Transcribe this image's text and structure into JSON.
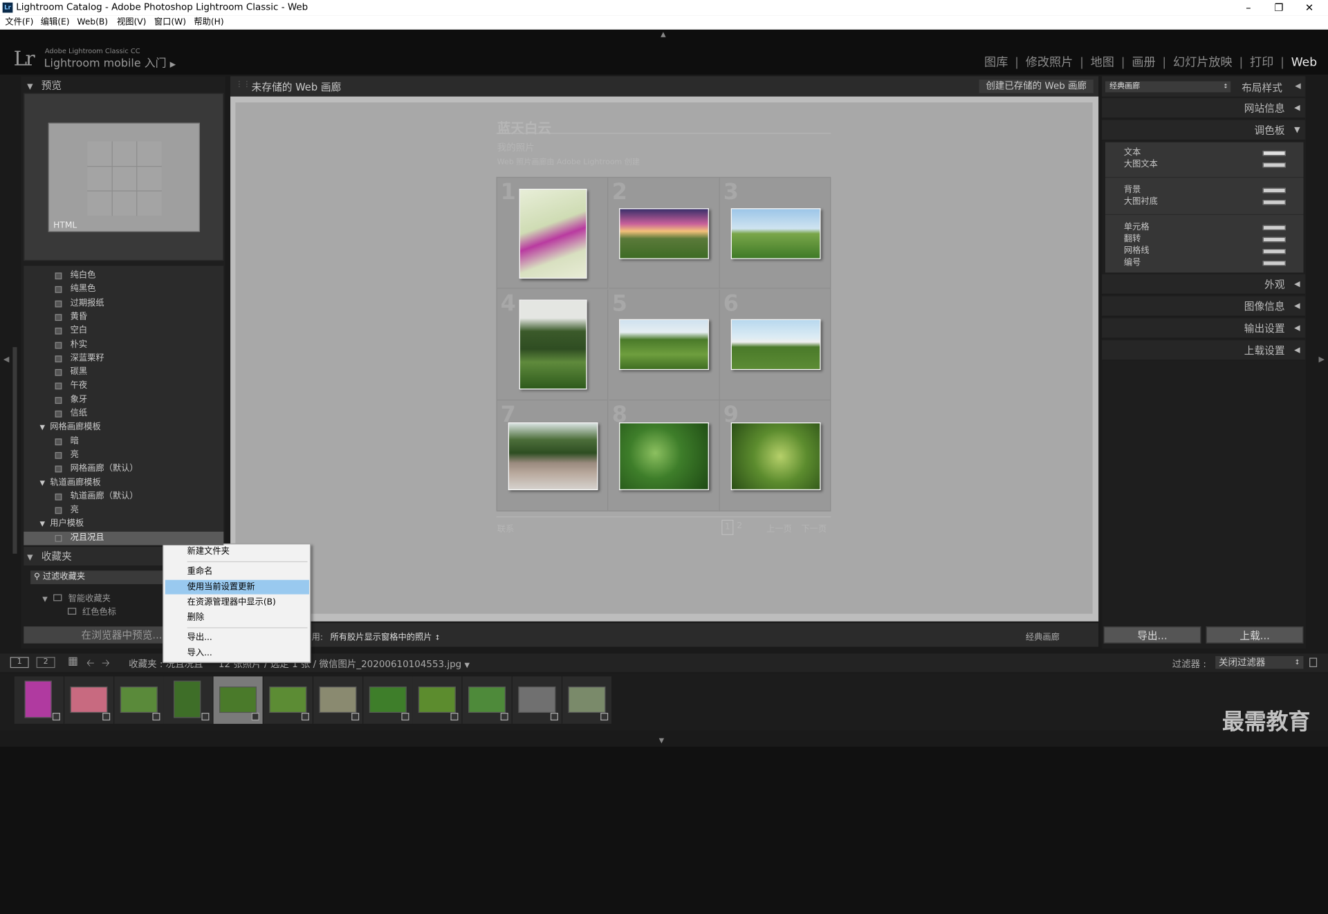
{
  "window": {
    "title": "Lightroom Catalog - Adobe Photoshop Lightroom Classic - Web",
    "app_icon": "Lr",
    "controls": [
      "minimize-icon",
      "maximize-icon",
      "close-icon"
    ]
  },
  "menubar": [
    "文件(F)",
    "编辑(E)",
    "Web(B)",
    "视图(V)",
    "窗口(W)",
    "帮助(H)"
  ],
  "header": {
    "logo": "Lr",
    "brand_line1": "Adobe Lightroom Classic CC",
    "brand_line2": "Lightroom mobile 入门",
    "modules": [
      "图库",
      "修改照片",
      "地图",
      "画册",
      "幻灯片放映",
      "打印",
      "Web"
    ],
    "active_module": "Web"
  },
  "left": {
    "preview_title": "预览",
    "preview_label": "HTML",
    "templates": [
      {
        "label": "纯白色",
        "type": "item"
      },
      {
        "label": "纯黑色",
        "type": "item"
      },
      {
        "label": "过期报纸",
        "type": "item"
      },
      {
        "label": "黄昏",
        "type": "item"
      },
      {
        "label": "空白",
        "type": "item"
      },
      {
        "label": "朴实",
        "type": "item"
      },
      {
        "label": "深蓝栗籽",
        "type": "item"
      },
      {
        "label": "碳黑",
        "type": "item"
      },
      {
        "label": "午夜",
        "type": "item"
      },
      {
        "label": "象牙",
        "type": "item"
      },
      {
        "label": "信纸",
        "type": "item"
      },
      {
        "label": "网格画廊模板",
        "type": "folder"
      },
      {
        "label": "暗",
        "type": "item"
      },
      {
        "label": "亮",
        "type": "item"
      },
      {
        "label": "网格画廊（默认）",
        "type": "item"
      },
      {
        "label": "轨道画廊模板",
        "type": "folder"
      },
      {
        "label": "轨道画廊（默认）",
        "type": "item"
      },
      {
        "label": "亮",
        "type": "item"
      },
      {
        "label": "用户模板",
        "type": "folder"
      },
      {
        "label": "况且况且",
        "type": "item",
        "selected": true
      }
    ],
    "collections_title": "收藏夹",
    "filter_label": "过滤收藏夹",
    "smart_collections": "智能收藏夹",
    "red_label": "红色色标",
    "preview_in_browser": "在浏览器中预览..."
  },
  "center": {
    "title": "未存储的 Web 画廊",
    "create_button": "创建已存储的 Web 画廊",
    "gallery_title": "蓝天白云",
    "gallery_subtitle": "我的照片",
    "gallery_caption": "Web 照片画廊由 Adobe Lightroom 创建",
    "cell_numbers": [
      "1",
      "2",
      "3",
      "4",
      "5",
      "6",
      "7",
      "8",
      "9"
    ],
    "footer_left": "联系",
    "pager": [
      "1",
      "2",
      "上一页",
      "下一页"
    ],
    "use_label": "用:",
    "use_value": "所有胶片显示窗格中的照片",
    "style_label": "经典画廊"
  },
  "context_menu": {
    "items": [
      {
        "label": "新建文件夹",
        "highlighted": false
      },
      {
        "label": "重命名",
        "highlighted": false
      },
      {
        "label": "使用当前设置更新",
        "highlighted": true
      },
      {
        "label": "在资源管理器中显示(B)",
        "highlighted": false
      },
      {
        "label": "删除",
        "highlighted": false
      },
      {
        "label": "导出...",
        "highlighted": false
      },
      {
        "label": "导入...",
        "highlighted": false
      }
    ]
  },
  "right": {
    "layout_select": "经典画廊",
    "sections": [
      "布局样式",
      "网站信息",
      "调色板",
      "外观",
      "图像信息",
      "输出设置",
      "上载设置"
    ],
    "palette_groups": [
      [
        "文本",
        "大图文本"
      ],
      [
        "背景",
        "大图衬底"
      ],
      [
        "单元格",
        "翻转",
        "网格线",
        "编号"
      ]
    ],
    "export_button": "导出...",
    "upload_button": "上载..."
  },
  "bottombar": {
    "view_buttons": [
      "1",
      "2"
    ],
    "source": "收藏夹 : 况且况且",
    "count": "12 张照片 / 选定 1 张 / 微信图片_20200610104553.jpg",
    "filter_label": "过滤器 :",
    "filter_value": "关闭过滤器"
  },
  "watermark": "最需教育",
  "colors": {
    "accent_hl": "#99c9ef",
    "panel": "#2b2b2b",
    "bg": "#1a1a1a"
  }
}
